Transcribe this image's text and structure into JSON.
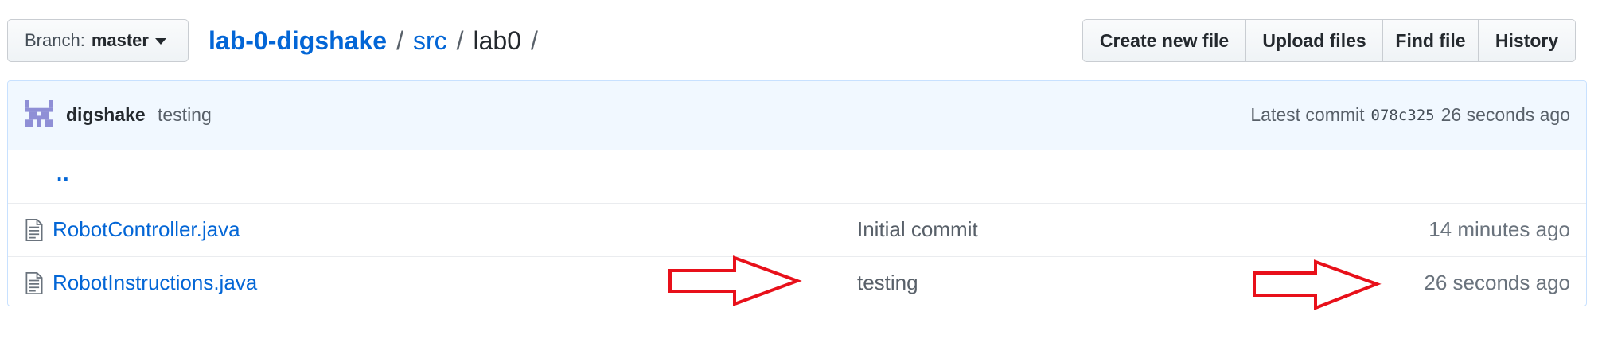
{
  "branch": {
    "label": "Branch:",
    "name": "master"
  },
  "breadcrumb": {
    "repo": "lab-0-digshake",
    "sep1": "/",
    "dir": "src",
    "sep2": "/",
    "current": "lab0",
    "sep3": "/"
  },
  "actions": {
    "create": "Create new file",
    "upload": "Upload files",
    "find": "Find file",
    "history": "History"
  },
  "commit": {
    "author": "digshake",
    "message": "testing",
    "latest_label": "Latest commit",
    "sha": "078c325",
    "age": "26 seconds ago"
  },
  "parent_link": "..",
  "files": [
    {
      "name": "RobotController.java",
      "message": "Initial commit",
      "age": "14 minutes ago",
      "icon": "file-icon"
    },
    {
      "name": "RobotInstructions.java",
      "message": "testing",
      "age": "26 seconds ago",
      "icon": "file-icon"
    }
  ],
  "annotations": {
    "arrow_color": "#e8101a",
    "count": 2
  },
  "colors": {
    "link": "#0366d6",
    "commit_bar": "#f1f8ff",
    "border": "#c8e1ff"
  }
}
